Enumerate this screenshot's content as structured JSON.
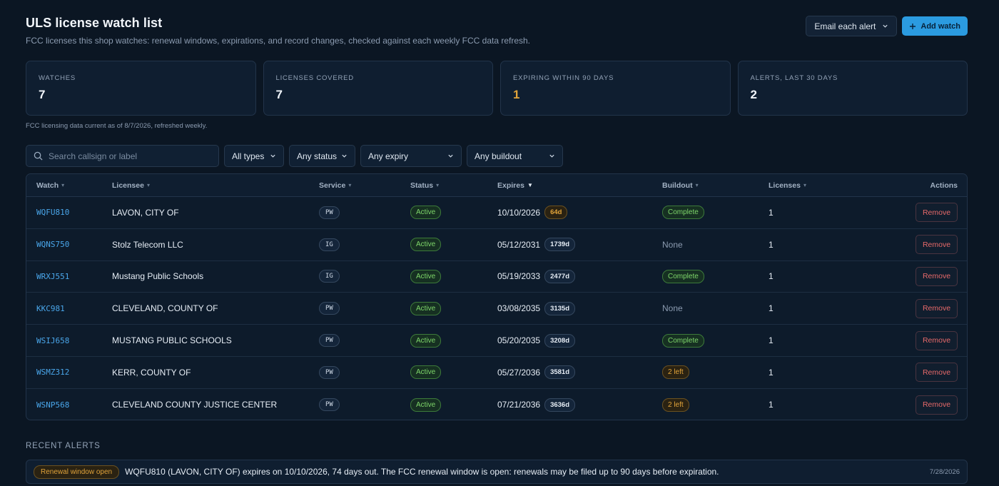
{
  "header": {
    "title": "ULS license watch list",
    "subtitle": "FCC licenses this shop watches: renewal windows, expirations, and record changes, checked against each weekly FCC data refresh.",
    "email_select": "Email each alert",
    "add_button": "Add watch"
  },
  "stats": [
    {
      "label": "WATCHES",
      "value": "7"
    },
    {
      "label": "LICENSES COVERED",
      "value": "7"
    },
    {
      "label": "EXPIRING WITHIN 90 DAYS",
      "value": "1"
    },
    {
      "label": "ALERTS, LAST 30 DAYS",
      "value": "2"
    }
  ],
  "data_note": "FCC licensing data current as of 8/7/2026, refreshed weekly.",
  "filters": {
    "search_placeholder": "Search callsign or label",
    "type": "All types",
    "status": "Any status",
    "expiry": "Any expiry",
    "buildout": "Any buildout"
  },
  "table": {
    "headers": {
      "watch": "Watch",
      "licensee": "Licensee",
      "service": "Service",
      "status": "Status",
      "expires": "Expires",
      "buildout": "Buildout",
      "licenses": "Licenses",
      "actions": "Actions"
    },
    "remove_label": "Remove",
    "rows": [
      {
        "callsign": "WQFU810",
        "licensee": "LAVON, CITY OF",
        "service": "PW",
        "status": "Active",
        "expires": "10/10/2026",
        "days": "64d",
        "buildout": "Complete",
        "licenses": "1"
      },
      {
        "callsign": "WQNS750",
        "licensee": "Stolz Telecom LLC",
        "service": "IG",
        "status": "Active",
        "expires": "05/12/2031",
        "days": "1739d",
        "buildout": "None",
        "licenses": "1"
      },
      {
        "callsign": "WRXJ551",
        "licensee": "Mustang Public Schools",
        "service": "IG",
        "status": "Active",
        "expires": "05/19/2033",
        "days": "2477d",
        "buildout": "Complete",
        "licenses": "1"
      },
      {
        "callsign": "KKC981",
        "licensee": "CLEVELAND, COUNTY OF",
        "service": "PW",
        "status": "Active",
        "expires": "03/08/2035",
        "days": "3135d",
        "buildout": "None",
        "licenses": "1"
      },
      {
        "callsign": "WSIJ658",
        "licensee": "MUSTANG PUBLIC SCHOOLS",
        "service": "PW",
        "status": "Active",
        "expires": "05/20/2035",
        "days": "3208d",
        "buildout": "Complete",
        "licenses": "1"
      },
      {
        "callsign": "WSMZ312",
        "licensee": "KERR, COUNTY OF",
        "service": "PW",
        "status": "Active",
        "expires": "05/27/2036",
        "days": "3581d",
        "buildout": "2 left",
        "licenses": "1"
      },
      {
        "callsign": "WSNP568",
        "licensee": "CLEVELAND COUNTY JUSTICE CENTER",
        "service": "PW",
        "status": "Active",
        "expires": "07/21/2036",
        "days": "3636d",
        "buildout": "2 left",
        "licenses": "1"
      }
    ]
  },
  "alerts": {
    "title": "RECENT ALERTS",
    "items": [
      {
        "badge": "Renewal window open",
        "text": "WQFU810 (LAVON, CITY OF) expires on 10/10/2026, 74 days out. The FCC renewal window is open: renewals may be filed up to 90 days before expiration.",
        "date": "7/28/2026"
      }
    ]
  },
  "colors": {
    "background": "#0b1623",
    "accent": "#2b9be0",
    "active_green": "#7ed66a",
    "warning_amber": "#e0a33a",
    "danger_red": "#e86a6a"
  }
}
